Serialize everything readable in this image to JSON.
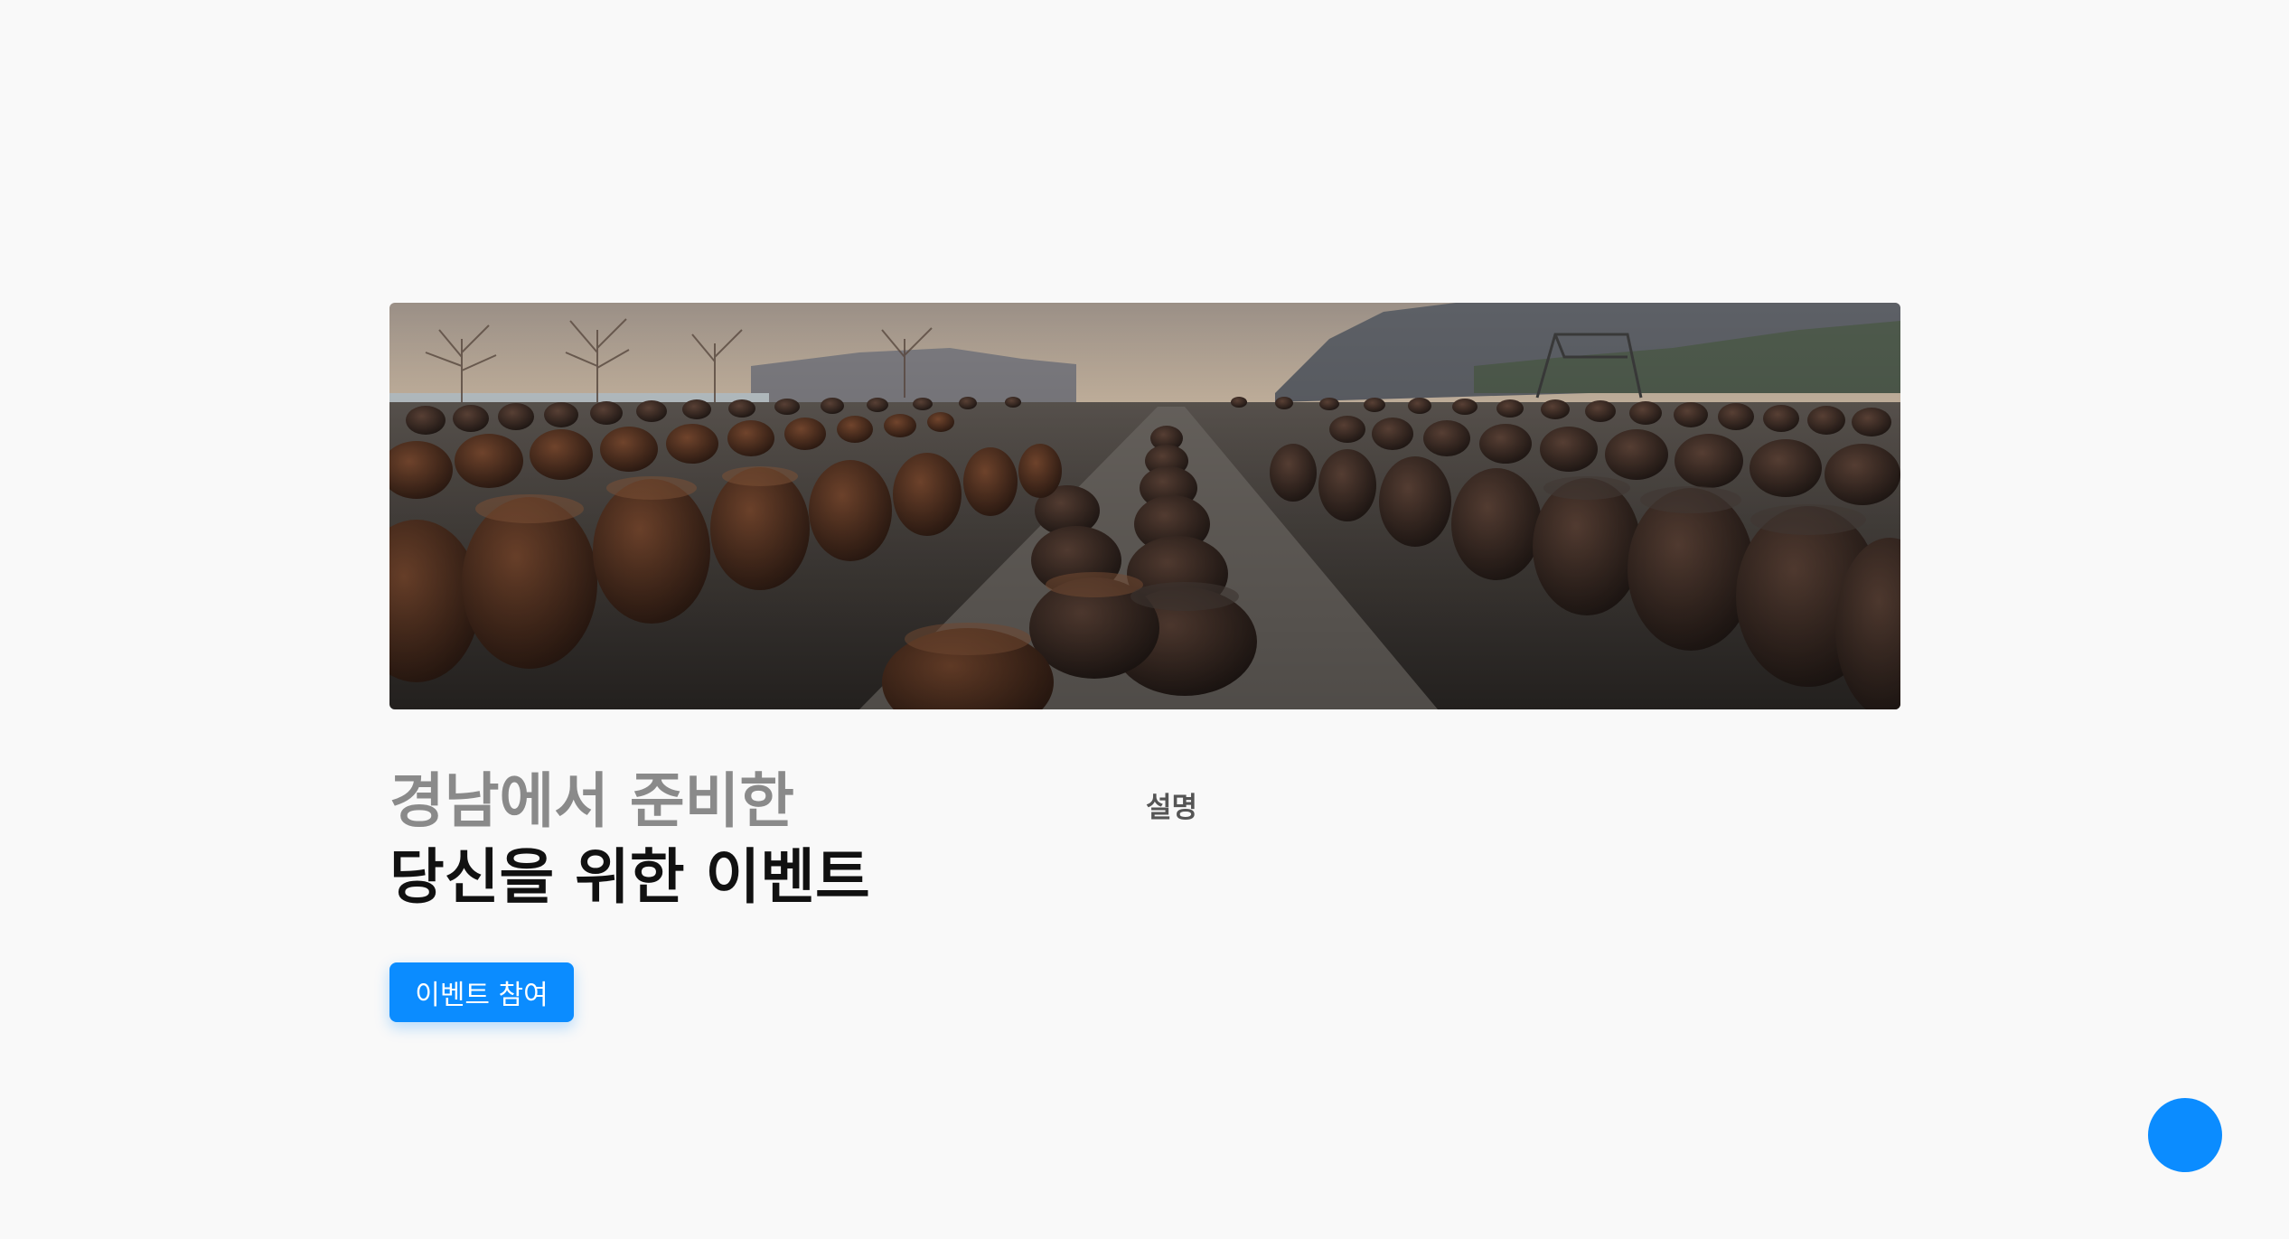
{
  "hero": {
    "image_name": "onggi-jar-field-photo"
  },
  "headline": {
    "line1": "경남에서 준비한",
    "line2": "당신을 위한 이벤트"
  },
  "description": {
    "label": "설명"
  },
  "cta": {
    "label": "이벤트 참여"
  },
  "colors": {
    "background": "#f9f9f9",
    "accent": "#0b8cff",
    "headline_muted": "#8a8a8a",
    "headline_strong": "#111111"
  },
  "fab": {
    "icon": "circle-action-icon"
  }
}
